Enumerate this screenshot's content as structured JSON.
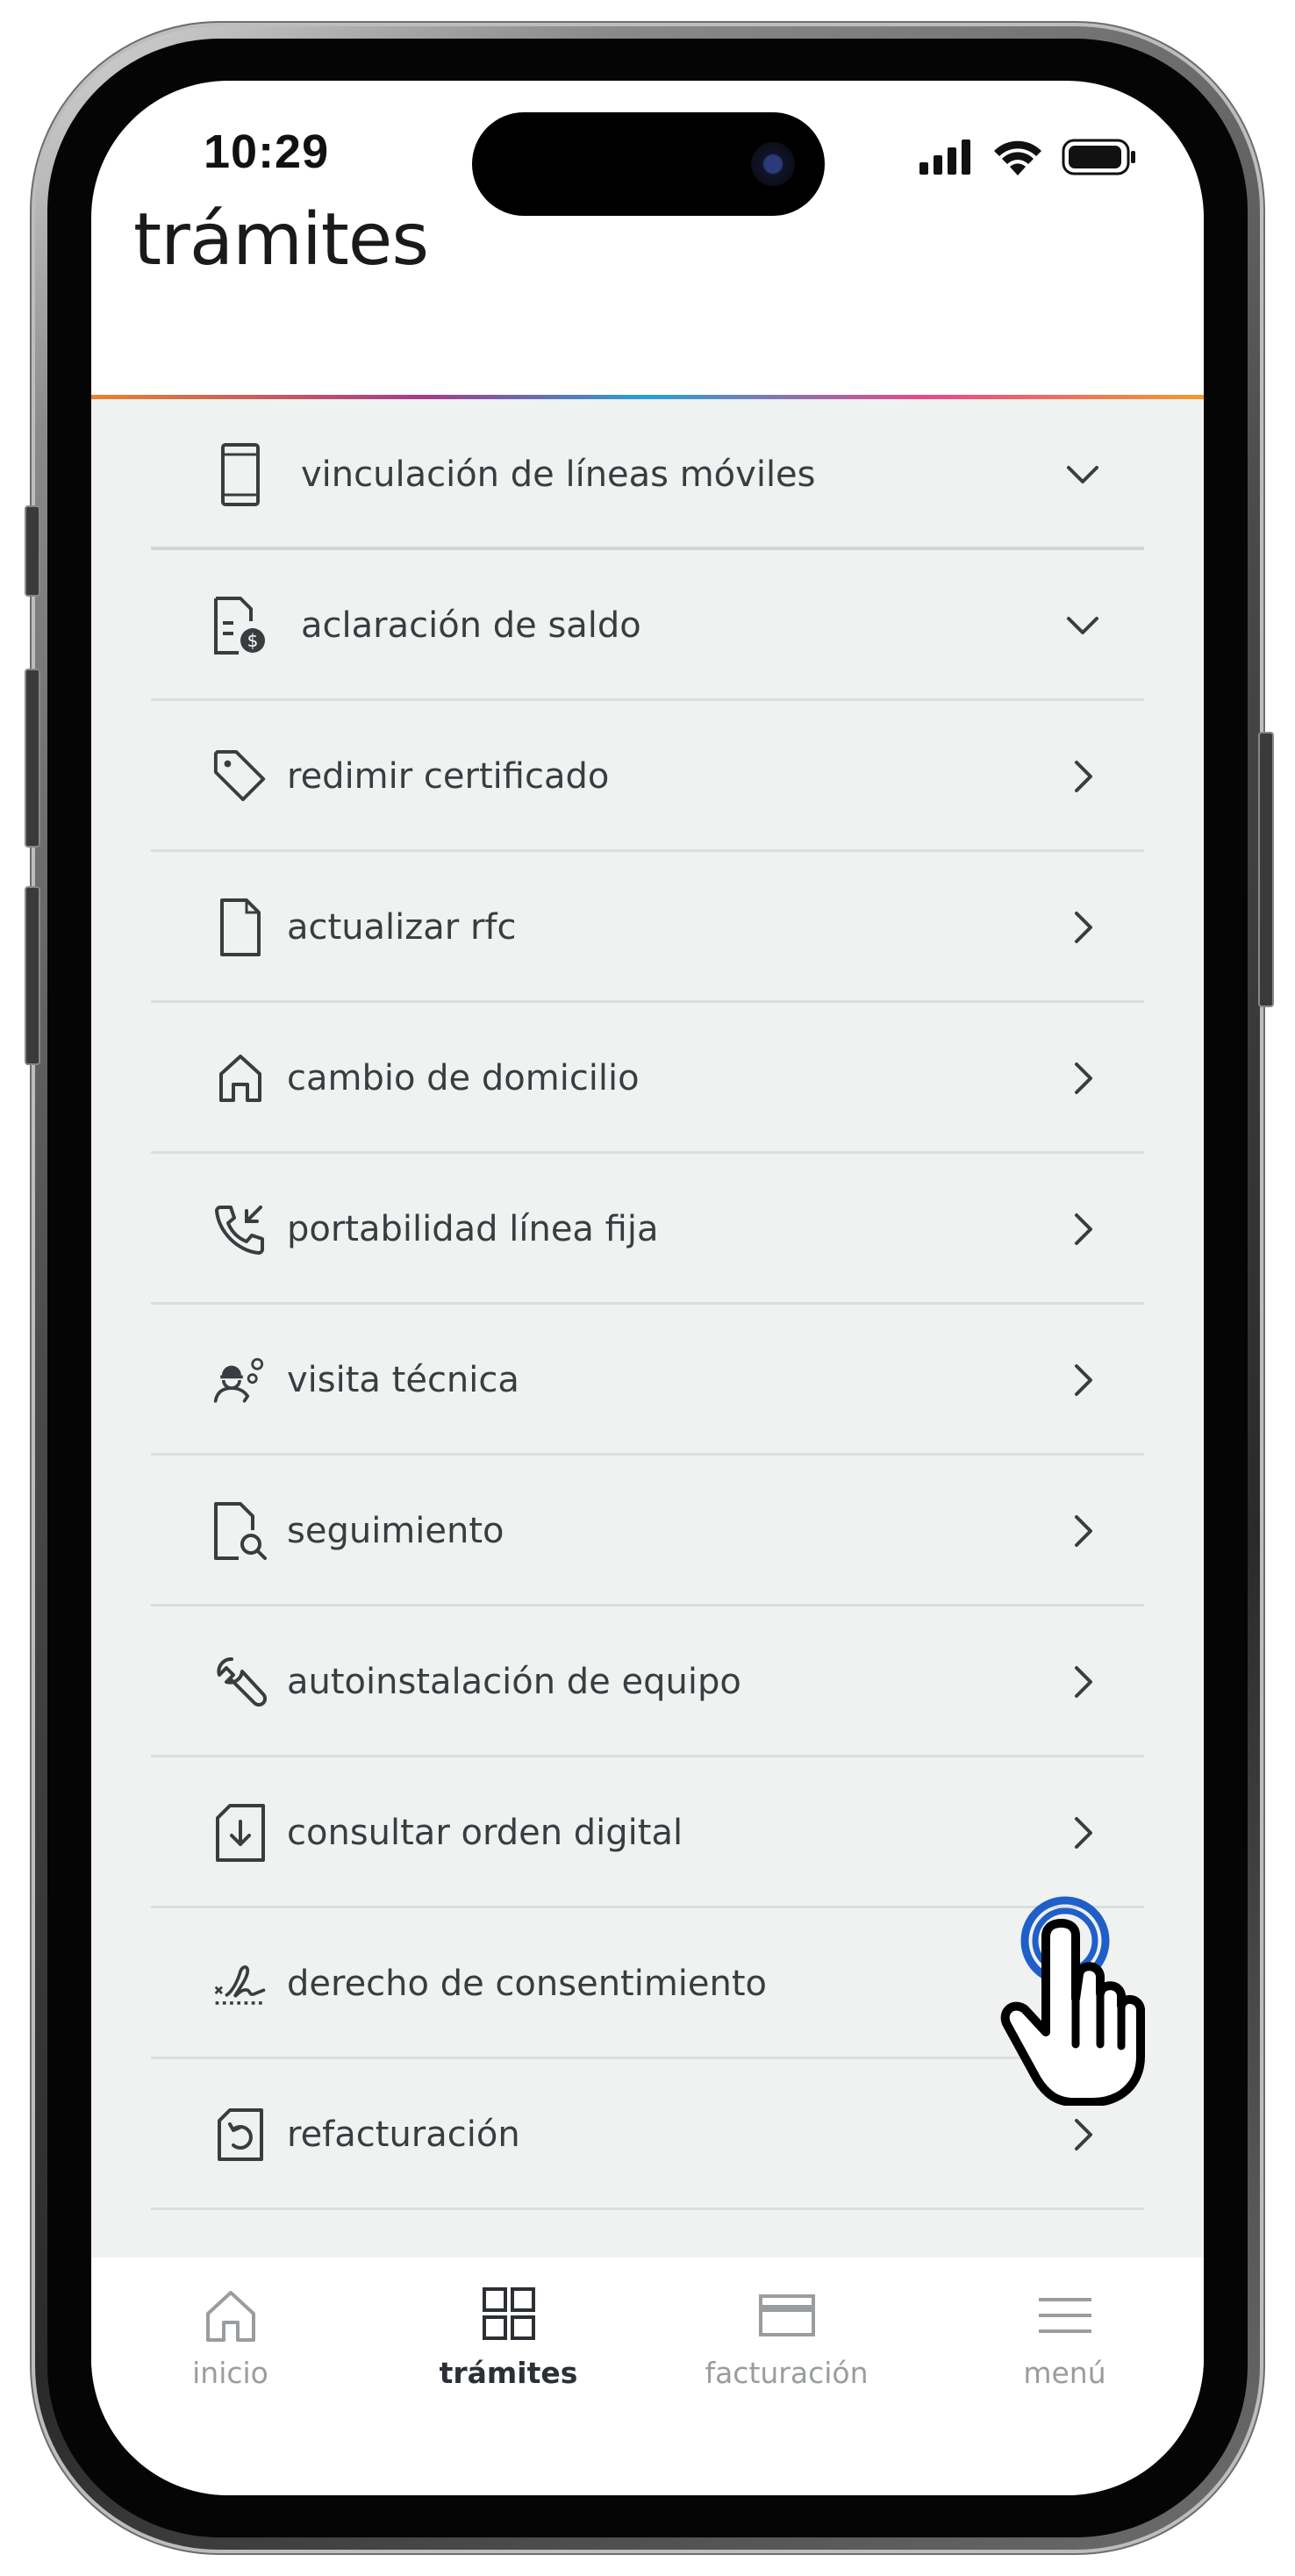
{
  "status_bar": {
    "time": "10:29"
  },
  "header": {
    "title": "trámites"
  },
  "items": [
    {
      "label": "vinculación de líneas móviles",
      "icon": "smartphone-icon",
      "chevron": "chevron-down"
    },
    {
      "label": "aclaración de saldo",
      "icon": "document-dollar-icon",
      "chevron": "chevron-down"
    },
    {
      "label": "redimir certificado",
      "icon": "tag-icon",
      "chevron": "chevron-right"
    },
    {
      "label": "actualizar rfc",
      "icon": "document-icon",
      "chevron": "chevron-right"
    },
    {
      "label": "cambio de domicilio",
      "icon": "home-icon",
      "chevron": "chevron-right"
    },
    {
      "label": "portabilidad línea fija",
      "icon": "phone-incoming-icon",
      "chevron": "chevron-right"
    },
    {
      "label": "visita técnica",
      "icon": "technician-icon",
      "chevron": "chevron-right"
    },
    {
      "label": "seguimiento",
      "icon": "document-search-icon",
      "chevron": "chevron-right"
    },
    {
      "label": "autoinstalación de equipo",
      "icon": "wrench-icon",
      "chevron": "chevron-right"
    },
    {
      "label": "consultar orden digital",
      "icon": "document-download-icon",
      "chevron": "chevron-right"
    },
    {
      "label": "derecho de consentimiento",
      "icon": "signature-icon",
      "chevron": "chevron-right"
    },
    {
      "label": "refacturación",
      "icon": "document-refresh-icon",
      "chevron": "chevron-right"
    }
  ],
  "tabbar": {
    "tabs": [
      {
        "label": "inicio",
        "icon": "home-icon",
        "active": false
      },
      {
        "label": "trámites",
        "icon": "grid-icon",
        "active": true
      },
      {
        "label": "facturación",
        "icon": "card-icon",
        "active": false
      },
      {
        "label": "menú",
        "icon": "hamburger-menu-icon",
        "active": false
      }
    ]
  },
  "colors": {
    "list_background": "#f0f1f1",
    "text": "#3a3d40",
    "tab_inactive": "#9a9d9f",
    "tap_indicator": "#1f5fc9"
  }
}
